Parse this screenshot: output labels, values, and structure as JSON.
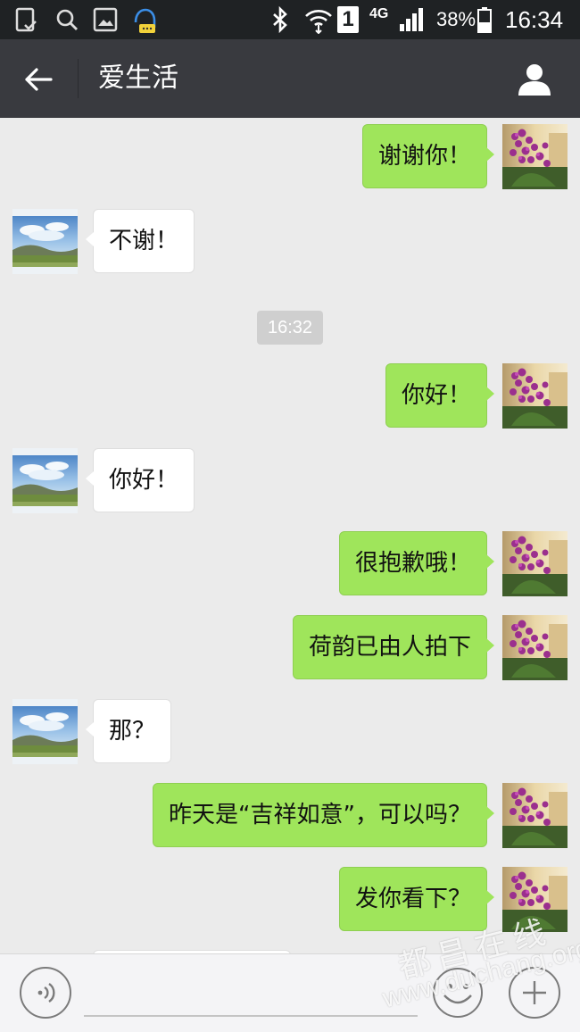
{
  "status_bar": {
    "battery": "38%",
    "time": "16:34",
    "network": "4G",
    "sim": "1",
    "icons": [
      "sim-card-icon",
      "search-icon",
      "gallery-icon",
      "assistant-icon",
      "bluetooth-icon",
      "wifi-icon",
      "signal-icon",
      "battery-icon"
    ]
  },
  "header": {
    "title": "爱生活",
    "back_icon": "arrow-left-icon",
    "profile_icon": "person-icon"
  },
  "chat": {
    "timestamp": "16:32",
    "messages": [
      {
        "from": "me",
        "text": "谢谢你！"
      },
      {
        "from": "them",
        "text": "不谢！"
      },
      {
        "from": "me",
        "text": "你好！"
      },
      {
        "from": "them",
        "text": "你好！"
      },
      {
        "from": "me",
        "text": "很抱歉哦！"
      },
      {
        "from": "me",
        "text": "荷韵已由人拍下"
      },
      {
        "from": "them",
        "text": "那？"
      },
      {
        "from": "me",
        "text": "昨天是“吉祥如意”，可以吗？"
      },
      {
        "from": "me",
        "text": "发你看下？"
      }
    ]
  },
  "input_bar": {
    "value": "",
    "voice_icon": "voice-icon",
    "emoji_icon": "emoji-icon",
    "plus_icon": "plus-icon"
  },
  "watermark": {
    "line1": "都昌在线",
    "line2": "www.duchang.org"
  },
  "colors": {
    "my_bubble": "#9fe55b",
    "their_bubble": "#ffffff",
    "header_bg": "#393a3f",
    "chat_bg": "#ebebeb"
  }
}
